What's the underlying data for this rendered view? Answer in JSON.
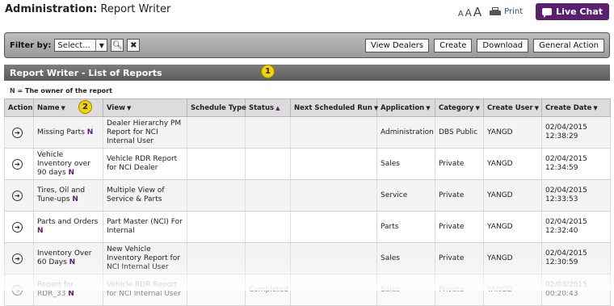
{
  "header": {
    "title_bold": "Administration:",
    "title_rest": "Report Writer",
    "font_small": "A",
    "font_medium": "A",
    "font_large": "A",
    "print_label": "Print",
    "live_chat_label": "Live Chat"
  },
  "filter": {
    "label": "Filter by:",
    "select_value": "Select...",
    "buttons": {
      "view_dealers": "View Dealers",
      "create": "Create",
      "download": "Download",
      "general_action": "General Action"
    }
  },
  "panel": {
    "title": "Report Writer - List of Reports",
    "legend_mark": "N",
    "legend_text": "= The owner of the report",
    "callout_1": "1",
    "callout_2": "2"
  },
  "table": {
    "headers": {
      "action": "Action",
      "name": "Name",
      "view": "View",
      "schedule_type": "Schedule Type",
      "status": "Status",
      "next_run": "Next Scheduled Run",
      "application": "Application",
      "category": "Category",
      "create_user": "Create User",
      "create_date": "Create Date"
    },
    "owner_mark": "N",
    "rows": [
      {
        "name": "Missing Parts",
        "view": "Dealer Hierarchy PM Report for NCI Internal User",
        "schedule": "",
        "status": "",
        "next_run": "",
        "application": "Administration",
        "category": "DBS Public",
        "user": "YANGD",
        "date": "02/04/2015",
        "time": "12:38:29"
      },
      {
        "name": "Vehicle Inventory over 90 days",
        "view": "Vehicle RDR Report for NCI Dealer",
        "schedule": "",
        "status": "",
        "next_run": "",
        "application": "Sales",
        "category": "Private",
        "user": "YANGD",
        "date": "02/04/2015",
        "time": "12:34:59"
      },
      {
        "name": "Tires, Oil and Tune-ups",
        "view": "Multiple View of Service & Parts",
        "schedule": "",
        "status": "",
        "next_run": "",
        "application": "Service",
        "category": "Private",
        "user": "YANGD",
        "date": "02/04/2015",
        "time": "12:33:53"
      },
      {
        "name": "Parts and Orders",
        "view": "Part Master (NCI) For Internal",
        "schedule": "",
        "status": "",
        "next_run": "",
        "application": "Parts",
        "category": "Private",
        "user": "YANGD",
        "date": "02/04/2015",
        "time": "12:32:40"
      },
      {
        "name": "Inventory Over 60 Days",
        "view": "New Vehicle Inventory Report for NCI Internal User",
        "schedule": "",
        "status": "",
        "next_run": "",
        "application": "Sales",
        "category": "Private",
        "user": "YANGD",
        "date": "02/04/2015",
        "time": "12:30:59"
      },
      {
        "name": "Report for RDR_33",
        "view": "Vehicle RDR Report for NCI Internal User",
        "schedule": "",
        "status": "Completed",
        "next_run": "",
        "application": "Sales",
        "category": "Private",
        "user": "YANGD",
        "date": "02/03/2015",
        "time": "00:20:43"
      }
    ]
  }
}
